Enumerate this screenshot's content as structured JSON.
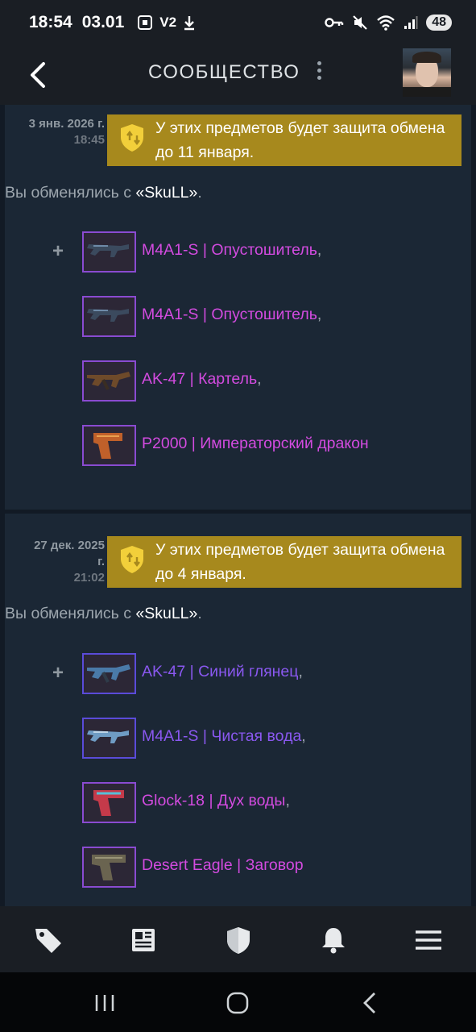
{
  "status_bar": {
    "time": "18:54",
    "date": "03.01",
    "v2": "V2",
    "battery": "48"
  },
  "header": {
    "title": "СООБЩЕСТВО"
  },
  "trades": [
    {
      "date": "3 янв. 2026 г.",
      "time": "18:45",
      "protection": "У этих предметов будет защита обмена до 11 января.",
      "intro_prefix": "Вы обменялись с ",
      "partner": "«SkuLL»",
      "intro_suffix": ".",
      "items": [
        {
          "name": "M4A1-S | Опустошитель",
          "suffix": ",",
          "color": "#d34be0"
        },
        {
          "name": "M4A1-S | Опустошитель",
          "suffix": ",",
          "color": "#d34be0"
        },
        {
          "name": "AK-47 | Картель",
          "suffix": ",",
          "color": "#d34be0"
        },
        {
          "name": "P2000 | Императорский дракон",
          "suffix": "",
          "color": "#d34be0"
        }
      ]
    },
    {
      "date_line1": "27 дек. 2025",
      "date_line2": "г.",
      "time": "21:02",
      "protection": "У этих предметов будет защита обмена до 4 января.",
      "intro_prefix": "Вы обменялись с ",
      "partner": "«SkuLL»",
      "intro_suffix": ".",
      "items": [
        {
          "name": "AK-47 | Синий глянец",
          "suffix": ",",
          "color": "#8a58f0"
        },
        {
          "name": "M4A1-S | Чистая вода",
          "suffix": ",",
          "color": "#8a58f0"
        },
        {
          "name": "Glock-18 | Дух воды",
          "suffix": ",",
          "color": "#d34be0"
        },
        {
          "name": "Desert Eagle | Заговор",
          "suffix": "",
          "color": "#d34be0"
        }
      ]
    }
  ],
  "plus_sign": "+",
  "bottom_nav": [
    "tag-icon",
    "news-icon",
    "shield-icon",
    "bell-icon",
    "menu-icon"
  ]
}
